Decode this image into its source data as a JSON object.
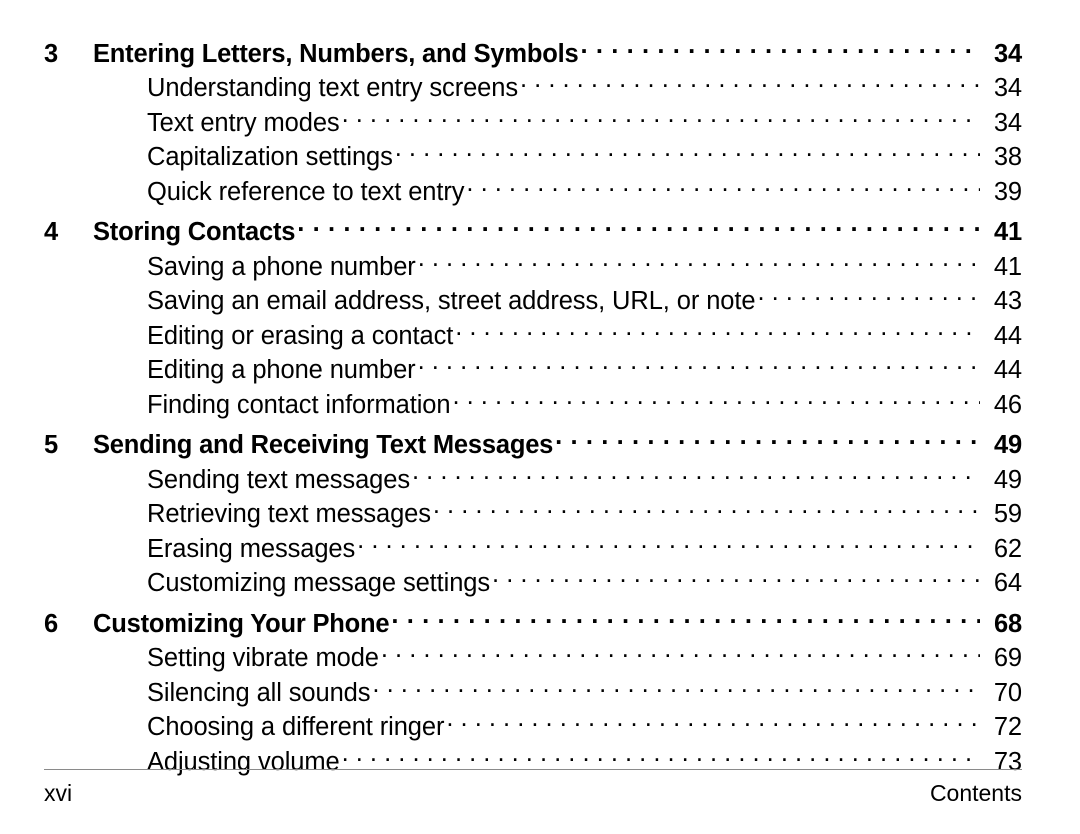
{
  "document": {
    "type": "table-of-contents",
    "page_label": "xvi",
    "footer_section": "Contents",
    "leader_char": "."
  },
  "toc": {
    "chapters": [
      {
        "number": "3",
        "title": "Entering Letters, Numbers, and Symbols",
        "page": "34",
        "entries": [
          {
            "title": "Understanding text entry screens",
            "page": "34"
          },
          {
            "title": "Text entry modes",
            "page": "34"
          },
          {
            "title": "Capitalization settings",
            "page": "38"
          },
          {
            "title": "Quick reference to text entry",
            "page": "39"
          }
        ]
      },
      {
        "number": "4",
        "title": "Storing Contacts",
        "page": "41",
        "entries": [
          {
            "title": "Saving a phone number",
            "page": "41"
          },
          {
            "title": "Saving an email address, street address, URL, or note",
            "page": "43"
          },
          {
            "title": "Editing or erasing a contact",
            "page": "44"
          },
          {
            "title": "Editing a phone number",
            "page": "44"
          },
          {
            "title": "Finding contact information",
            "page": "46"
          }
        ]
      },
      {
        "number": "5",
        "title": "Sending and Receiving Text Messages",
        "page": "49",
        "entries": [
          {
            "title": "Sending text messages",
            "page": "49"
          },
          {
            "title": "Retrieving text messages",
            "page": "59"
          },
          {
            "title": "Erasing messages",
            "page": "62"
          },
          {
            "title": "Customizing message settings",
            "page": "64"
          }
        ]
      },
      {
        "number": "6",
        "title": "Customizing Your Phone",
        "page": "68",
        "entries": [
          {
            "title": "Setting vibrate mode",
            "page": "69"
          },
          {
            "title": "Silencing all sounds",
            "page": "70"
          },
          {
            "title": "Choosing a different ringer",
            "page": "72"
          },
          {
            "title": "Adjusting volume",
            "page": "73"
          }
        ]
      }
    ]
  }
}
